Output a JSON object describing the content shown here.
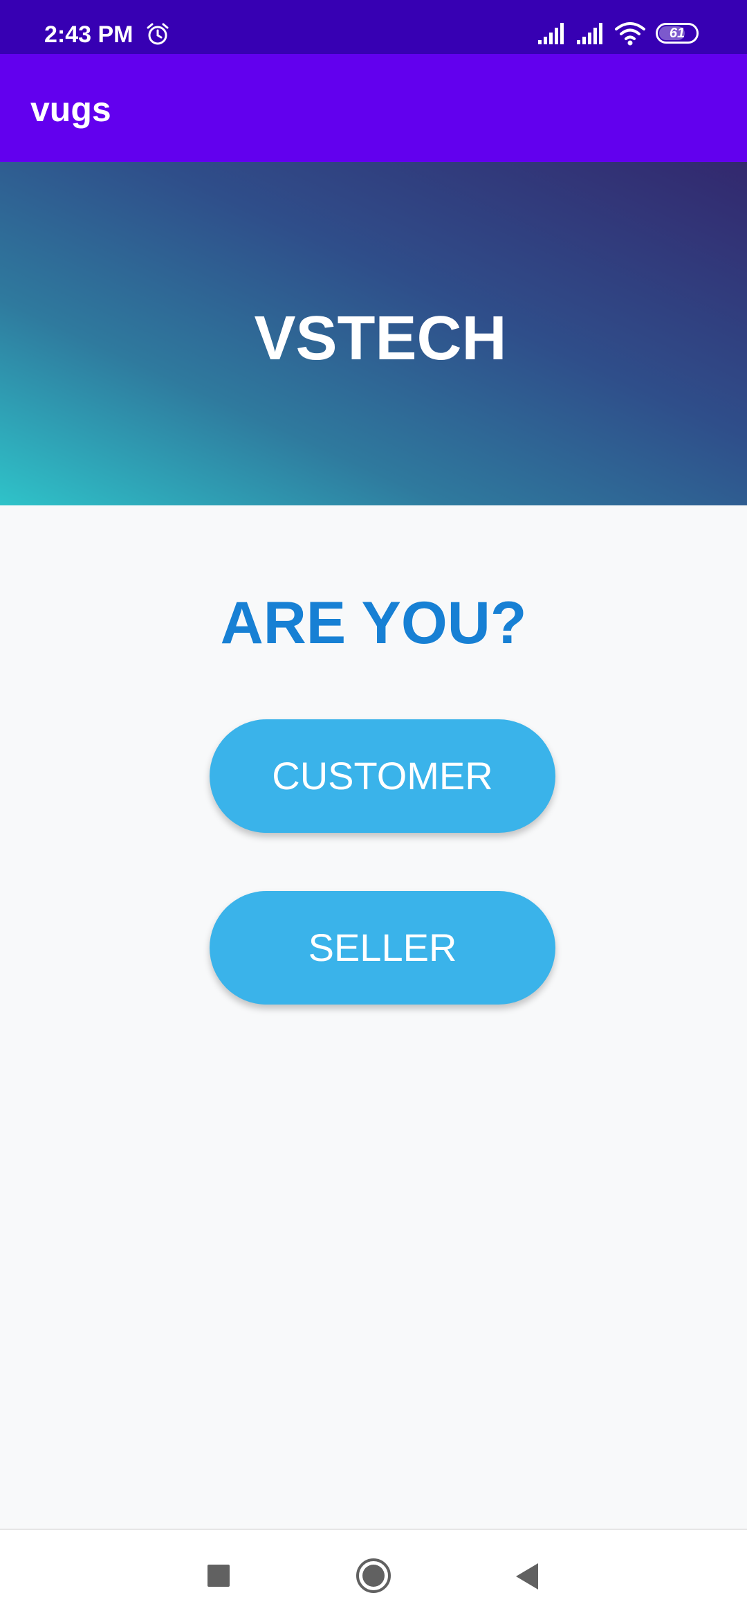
{
  "status_bar": {
    "time": "2:43 PM",
    "battery_level": "61",
    "icons": [
      "alarm-icon",
      "signal-icon",
      "signal-icon",
      "wifi-icon",
      "battery-icon"
    ]
  },
  "app_bar": {
    "title": "vugs"
  },
  "hero": {
    "title": "VSTECH"
  },
  "main": {
    "question": "ARE YOU?",
    "customer_label": "CUSTOMER",
    "seller_label": "SELLER"
  },
  "nav_bar": {
    "icons": [
      "recents-icon",
      "home-icon",
      "back-icon"
    ]
  },
  "colors": {
    "status_bar": "#3700b3",
    "app_bar": "#6200ee",
    "question_text": "#1780d4",
    "button": "#3ab3ea",
    "background": "#f8f9fa"
  }
}
